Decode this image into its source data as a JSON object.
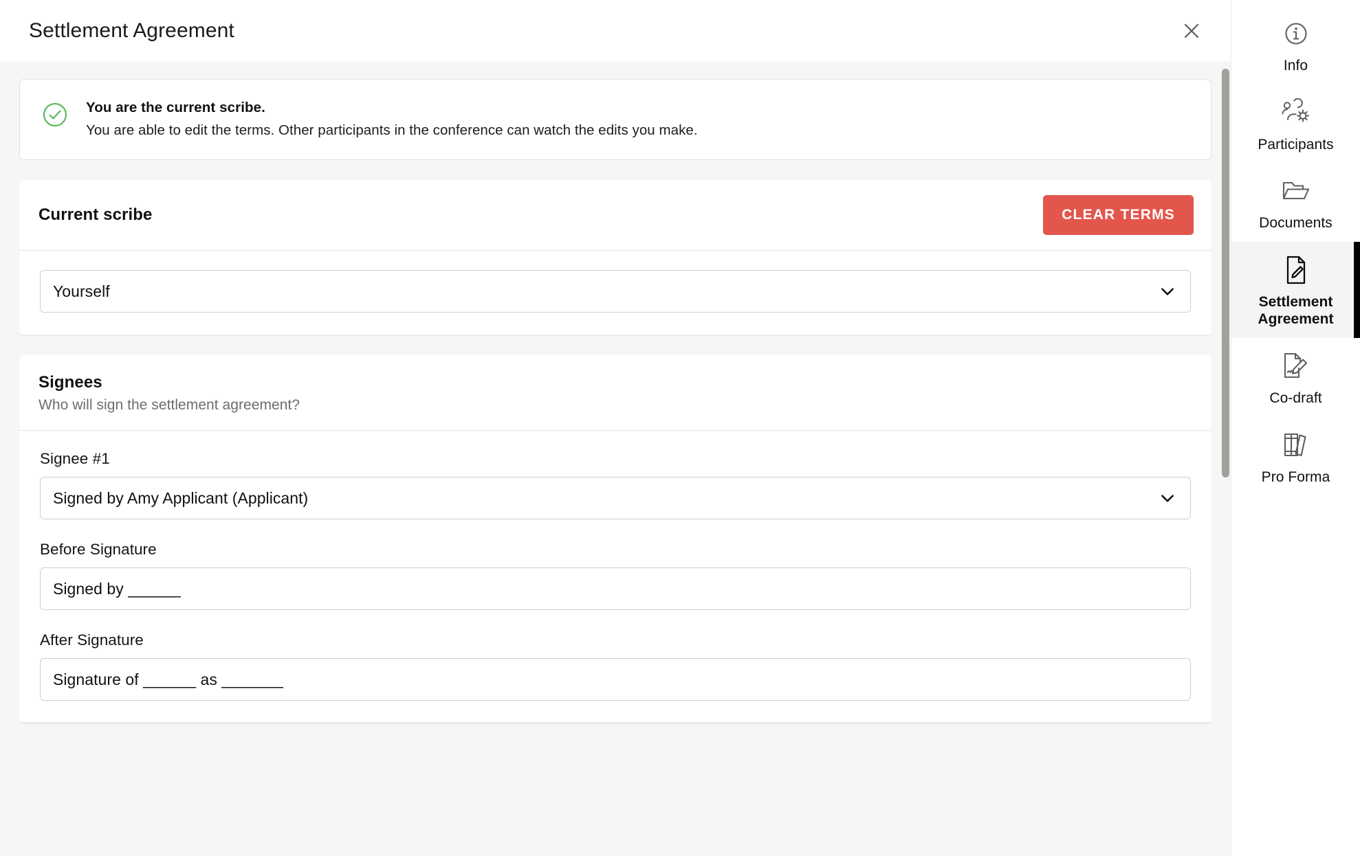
{
  "header": {
    "title": "Settlement Agreement",
    "close_icon": "close-icon"
  },
  "alert": {
    "icon": "check-circle-icon",
    "icon_color": "#5cb85c",
    "title": "You are the current scribe.",
    "description": "You are able to edit the terms. Other participants in the conference can watch the edits you make."
  },
  "scribe_card": {
    "title": "Current scribe",
    "clear_button_label": "CLEAR TERMS",
    "clear_button_color": "#e2564c",
    "select_value": "Yourself",
    "select_icon": "chevron-down-icon"
  },
  "signees": {
    "title": "Signees",
    "subtitle": "Who will sign the settlement agreement?",
    "entries": [
      {
        "label": "Signee #1",
        "select_value": "Signed by Amy Applicant (Applicant)",
        "select_icon": "chevron-down-icon",
        "before_label": "Before Signature",
        "before_value": "Signed by ______",
        "after_label": "After Signature",
        "after_value": "Signature of ______ as _______"
      }
    ]
  },
  "scrollbar": {
    "name": "vertical-scrollbar",
    "thumb_color": "#a0a09c"
  },
  "sidebar": {
    "items": [
      {
        "label": "Info",
        "icon": "info-circle-icon",
        "active": false
      },
      {
        "label": "Participants",
        "icon": "people-gear-icon",
        "active": false
      },
      {
        "label": "Documents",
        "icon": "folder-open-icon",
        "active": false
      },
      {
        "label": "Settlement Agreement",
        "icon": "document-pencil-icon",
        "active": true
      },
      {
        "label": "Co-draft",
        "icon": "document-signature-pen-icon",
        "active": false
      },
      {
        "label": "Pro Forma",
        "icon": "books-icon",
        "active": false
      }
    ]
  }
}
